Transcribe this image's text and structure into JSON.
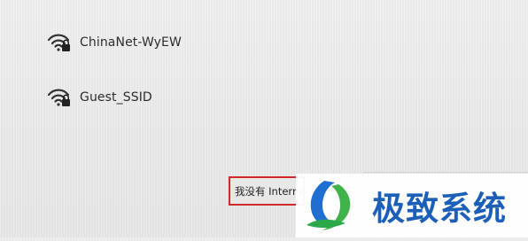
{
  "networks": [
    {
      "name": "ChinaNet-WyEW",
      "icon": "wifi-lock-icon"
    },
    {
      "name": "Guest_SSID",
      "icon": "wifi-lock-icon"
    }
  ],
  "no_internet_button": {
    "label": "我没有 Internet"
  },
  "watermark": {
    "text": "极致系统",
    "text_color": "#1b5fb8",
    "logo_colors": [
      "#1e6fd1",
      "#3fb34a"
    ]
  },
  "colors": {
    "highlight_border": "#d12a2a",
    "background": "#ececec"
  }
}
